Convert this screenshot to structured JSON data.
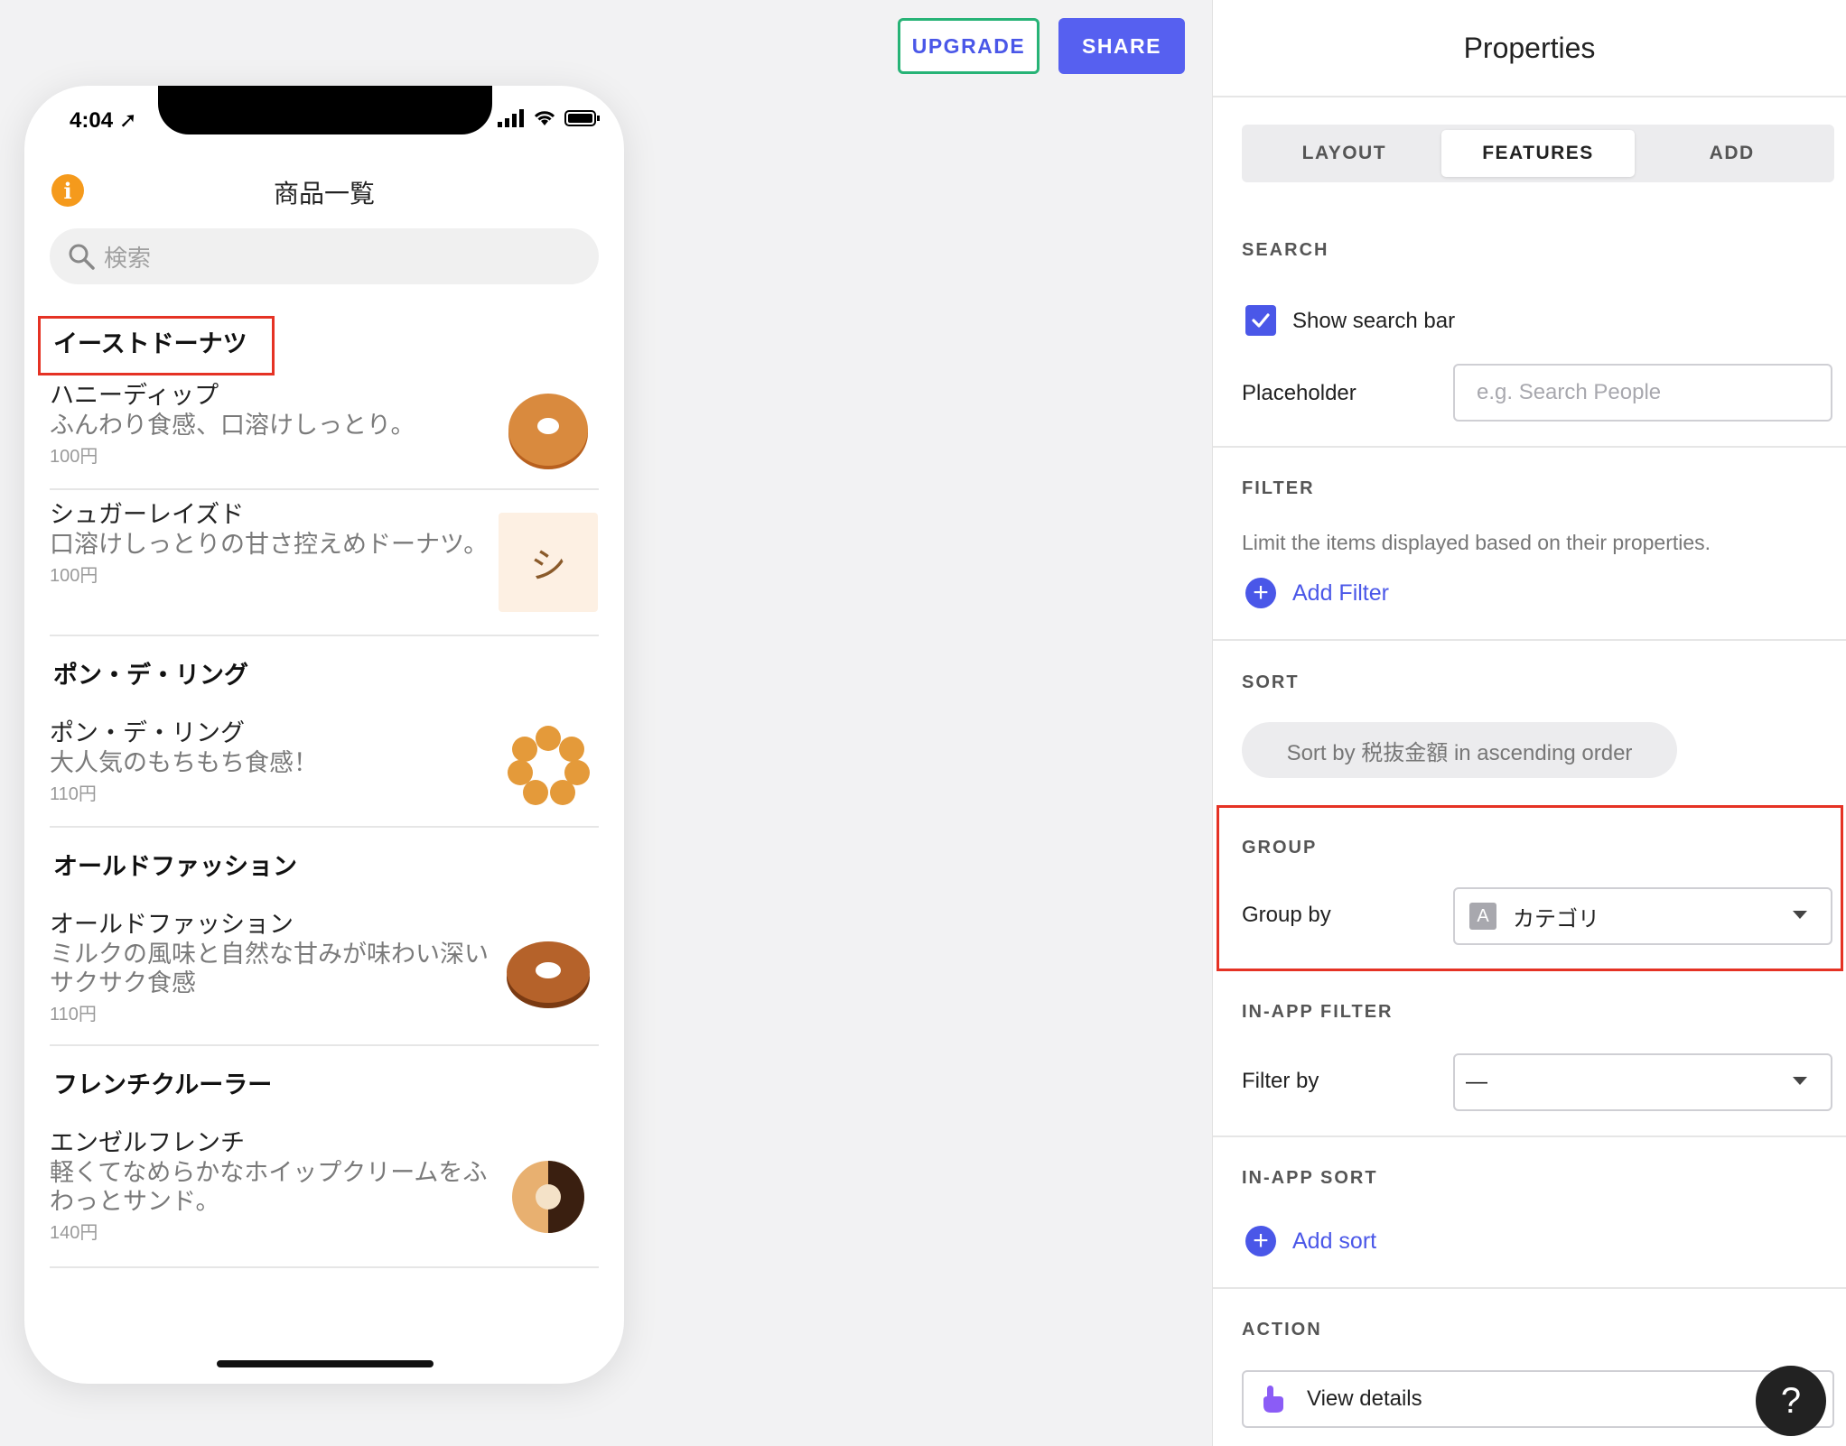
{
  "toolbar": {
    "upgrade_label": "UPGRADE",
    "share_label": "SHARE"
  },
  "phone": {
    "time": "4:04",
    "title": "商品一覧",
    "search_placeholder": "検索",
    "groups": [
      {
        "title": "イーストドーナツ",
        "items": [
          {
            "name": "ハニーディップ",
            "desc": "ふんわり食感、口溶けしっとり。",
            "price": "100円",
            "thumb": "donut-glazed"
          },
          {
            "name": "シュガーレイズド",
            "desc": "口溶けしっとりの甘さ控えめドーナツ。",
            "price": "100円",
            "thumb_text": "シ"
          }
        ]
      },
      {
        "title": "ポン・デ・リング",
        "items": [
          {
            "name": "ポン・デ・リング",
            "desc": "大人気のもちもち食感！",
            "price": "110円",
            "thumb": "donut-ring"
          }
        ]
      },
      {
        "title": "オールドファッション",
        "items": [
          {
            "name": "オールドファッション",
            "desc": "ミルクの風味と自然な甘みが味わい深いサクサク食感",
            "price": "110円",
            "thumb": "donut-old"
          }
        ]
      },
      {
        "title": "フレンチクルーラー",
        "items": [
          {
            "name": "エンゼルフレンチ",
            "desc": "軽くてなめらかなホイップクリームをふわっとサンド。",
            "price": "140円",
            "thumb": "donut-cruller"
          }
        ]
      }
    ]
  },
  "panel": {
    "title": "Properties",
    "tabs": [
      "LAYOUT",
      "FEATURES",
      "ADD"
    ],
    "active_tab": "FEATURES",
    "search": {
      "label": "SEARCH",
      "show_label": "Show search bar",
      "show_checked": true,
      "placeholder_label": "Placeholder",
      "placeholder_hint": "e.g. Search People"
    },
    "filter": {
      "label": "FILTER",
      "desc": "Limit the items displayed based on their properties.",
      "add_label": "Add Filter"
    },
    "sort": {
      "label": "SORT",
      "value": "Sort by 税抜金額 in ascending order"
    },
    "group": {
      "label": "GROUP",
      "by_label": "Group by",
      "type_badge": "A",
      "value": "カテゴリ"
    },
    "inapp_filter": {
      "label": "IN-APP FILTER",
      "by_label": "Filter by",
      "value": "—"
    },
    "inapp_sort": {
      "label": "IN-APP SORT",
      "add_label": "Add sort"
    },
    "action": {
      "label": "ACTION",
      "value": "View details"
    }
  },
  "help_label": "?",
  "colors": {
    "accent": "#4a57e8",
    "highlight": "#e53224",
    "info": "#f59a1c",
    "upgrade_border": "#27b376"
  }
}
